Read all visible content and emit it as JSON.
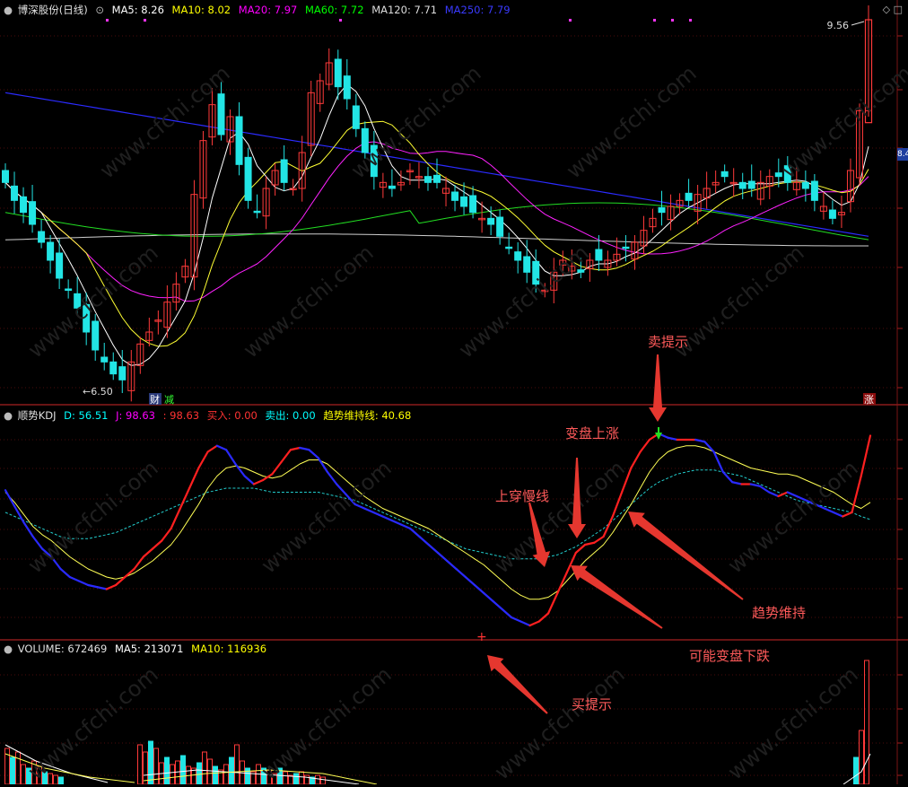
{
  "window": {
    "corner_icons": [
      "◇",
      "□"
    ]
  },
  "price_panel": {
    "title": "博深股份(日线)",
    "ma": [
      {
        "label": "MA5: 8.26",
        "color": "#ffffff"
      },
      {
        "label": "MA10: 8.02",
        "color": "#ffff00"
      },
      {
        "label": "MA20: 7.97",
        "color": "#ff00ff"
      },
      {
        "label": "MA60: 7.72",
        "color": "#00ff00"
      },
      {
        "label": "MA120: 7.71",
        "color": "#dddddd"
      },
      {
        "label": "MA250: 7.79",
        "color": "#3333ff"
      }
    ],
    "high_label": "9.56",
    "low_label": "6.50",
    "edge_tag": "8.4",
    "badge_cai": "财",
    "badge_jian": "减",
    "badge_zhang": "涨"
  },
  "kdj_panel": {
    "title": "顺势KDJ",
    "items": [
      {
        "label": "D: 56.51",
        "color": "#00ffff"
      },
      {
        "label": "J: 98.63",
        "color": "#ff00ff"
      },
      {
        "label": ": 98.63",
        "color": "#ff3333"
      },
      {
        "label": "买入: 0.00",
        "color": "#ff3333"
      },
      {
        "label": "卖出: 0.00",
        "color": "#00ffff"
      },
      {
        "label": "趋势维持线: 40.68",
        "color": "#ffff00"
      }
    ]
  },
  "volume_panel": {
    "title": "VOLUME: 672469",
    "items": [
      {
        "label": "MA5: 213071",
        "color": "#ffffff"
      },
      {
        "label": "MA10: 116936",
        "color": "#ffff00"
      }
    ]
  },
  "annotations": {
    "sell_hint": "卖提示",
    "turn_up": "变盘上涨",
    "cross_slow": "上穿慢线",
    "trend_hold": "趋势维持",
    "maybe_down": "可能变盘下跌",
    "buy_hint": "买提示"
  },
  "watermark": "www.cfchi.com",
  "chart_data": [
    {
      "type": "candlestick",
      "title": "博深股份(日线)",
      "series_names": [
        "MA5",
        "MA10",
        "MA20",
        "MA60",
        "MA120",
        "MA250"
      ],
      "ma_last": [
        8.26,
        8.02,
        7.97,
        7.72,
        7.71,
        7.79
      ],
      "close": [
        8.2,
        8.05,
        7.95,
        7.85,
        7.7,
        7.55,
        7.4,
        7.3,
        7.15,
        6.95,
        6.8,
        6.7,
        6.6,
        6.55,
        6.7,
        6.85,
        6.95,
        7.05,
        7.2,
        7.35,
        7.5,
        8.1,
        8.55,
        8.85,
        8.6,
        8.75,
        8.35,
        8.05,
        7.95,
        8.15,
        8.3,
        8.2,
        8.15,
        8.45,
        8.95,
        9.05,
        9.2,
        9.0,
        8.9,
        8.65,
        8.45,
        8.25,
        8.2,
        8.15,
        8.2,
        8.3,
        8.25,
        8.2,
        8.2,
        8.15,
        8.05,
        8.0,
        7.95,
        7.9,
        7.85,
        7.75,
        7.65,
        7.55,
        7.45,
        7.35,
        7.3,
        7.45,
        7.55,
        7.5,
        7.45,
        7.55,
        7.55,
        7.55,
        7.6,
        7.65,
        7.7,
        7.8,
        7.9,
        7.95,
        8.0,
        8.05,
        8.05,
        8.1,
        8.15,
        8.2,
        8.25,
        8.2,
        8.15,
        8.15,
        8.2,
        8.25,
        8.25,
        8.2,
        8.2,
        8.15,
        8.05,
        8.0,
        7.9,
        7.95,
        8.3,
        8.8,
        9.56
      ],
      "extremes": {
        "high": 9.56,
        "low": 6.5
      }
    },
    {
      "type": "line",
      "title": "顺势KDJ",
      "ylim": [
        0,
        100
      ],
      "series": [
        {
          "name": "J",
          "values": [
            71,
            63,
            55,
            48,
            42,
            38,
            32,
            28,
            26,
            24,
            23,
            22,
            24,
            28,
            32,
            38,
            42,
            46,
            52,
            62,
            72,
            82,
            90,
            93,
            91,
            84,
            78,
            74,
            76,
            79,
            85,
            91,
            92,
            91,
            87,
            80,
            74,
            69,
            64,
            62,
            60,
            58,
            56,
            54,
            52,
            48,
            44,
            40,
            36,
            32,
            28,
            24,
            20,
            16,
            12,
            8,
            6,
            4,
            6,
            10,
            20,
            30,
            40,
            44,
            45,
            48,
            58,
            70,
            82,
            90,
            96,
            99,
            97,
            96,
            96,
            96,
            95,
            90,
            80,
            75,
            74,
            74,
            73,
            70,
            68,
            70,
            68,
            66,
            64,
            62,
            60,
            58,
            60,
            78,
            98
          ]
        },
        {
          "name": "趋势维持线",
          "values": [
            70,
            65,
            59,
            53,
            49,
            46,
            42,
            38,
            35,
            32,
            30,
            28,
            27,
            28,
            30,
            33,
            36,
            40,
            44,
            50,
            57,
            64,
            72,
            78,
            82,
            83,
            82,
            80,
            78,
            77,
            78,
            81,
            84,
            86,
            86,
            84,
            80,
            76,
            72,
            68,
            65,
            62,
            60,
            58,
            56,
            54,
            52,
            49,
            46,
            43,
            40,
            37,
            34,
            30,
            26,
            22,
            19,
            17,
            17,
            18,
            21,
            26,
            31,
            36,
            40,
            44,
            50,
            57,
            64,
            72,
            80,
            86,
            90,
            92,
            93,
            93,
            92,
            90,
            88,
            86,
            84,
            82,
            81,
            80,
            79,
            79,
            78,
            76,
            74,
            72,
            70,
            67,
            64,
            62,
            65
          ]
        },
        {
          "name": "D",
          "values": [
            60,
            58,
            56,
            54,
            52,
            50,
            48,
            47,
            47,
            47,
            48,
            49,
            50,
            52,
            54,
            56,
            58,
            60,
            62,
            64,
            66,
            68,
            70,
            71,
            72,
            72,
            72,
            72,
            71,
            70,
            70,
            70,
            70,
            70,
            70,
            69,
            68,
            67,
            66,
            64,
            62,
            60,
            58,
            56,
            54,
            52,
            50,
            48,
            46,
            44,
            42,
            41,
            40,
            39,
            38,
            37,
            37,
            37,
            37,
            38,
            39,
            41,
            43,
            46,
            49,
            52,
            56,
            60,
            64,
            68,
            72,
            75,
            77,
            79,
            80,
            81,
            81,
            81,
            80,
            79,
            78,
            76,
            74,
            72,
            70,
            68,
            66,
            65,
            64,
            63,
            62,
            61,
            60,
            58,
            56.51
          ]
        }
      ],
      "last": {
        "D": 56.51,
        "J": 98.63,
        "买入": 0.0,
        "卖出": 0.0,
        "趋势维持线": 40.68
      }
    },
    {
      "type": "bar",
      "title": "VOLUME",
      "last": {
        "VOLUME": 672469,
        "MA5": 213071,
        "MA10": 116936
      }
    }
  ]
}
